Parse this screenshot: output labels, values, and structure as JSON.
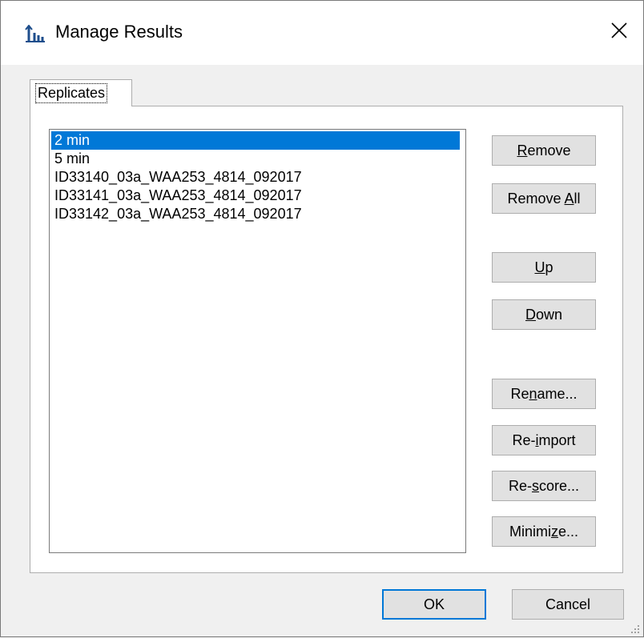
{
  "window": {
    "title": "Manage Results"
  },
  "tabs": [
    {
      "label": "Replicates"
    }
  ],
  "replicates": {
    "items": [
      "2 min",
      "5 min",
      "ID33140_03a_WAA253_4814_092017",
      "ID33141_03a_WAA253_4814_092017",
      "ID33142_03a_WAA253_4814_092017"
    ],
    "selected_index": 0
  },
  "buttons": {
    "remove": {
      "pre": "",
      "key": "R",
      "post": "emove"
    },
    "remove_all": {
      "pre": "Remove ",
      "key": "A",
      "post": "ll"
    },
    "up": {
      "pre": "",
      "key": "U",
      "post": "p"
    },
    "down": {
      "pre": "",
      "key": "D",
      "post": "own"
    },
    "rename": {
      "pre": "Re",
      "key": "n",
      "post": "ame..."
    },
    "reimport": {
      "pre": "Re-",
      "key": "i",
      "post": "mport"
    },
    "rescore": {
      "pre": "Re-",
      "key": "s",
      "post": "core..."
    },
    "minimize": {
      "pre": "Minimi",
      "key": "z",
      "post": "e..."
    },
    "ok": "OK",
    "cancel": "Cancel"
  },
  "icons": {
    "app": "peak-chart-icon",
    "close": "close-icon",
    "grip": "resize-grip-icon"
  },
  "colors": {
    "selection": "#0078d7",
    "app_icon": "#1e4e8c"
  }
}
